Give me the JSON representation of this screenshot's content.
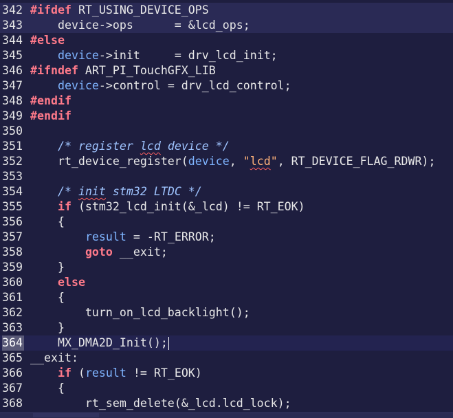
{
  "editor": {
    "cursor_line": "364",
    "lines": [
      {
        "num": "342",
        "tokens": [
          {
            "t": "pp",
            "v": "#ifdef"
          },
          {
            "t": "plain",
            "v": " RT_USING_DEVICE_OPS"
          }
        ]
      },
      {
        "num": "343",
        "tokens": [
          {
            "t": "plain",
            "v": "    device->ops      = &lcd_ops;"
          }
        ]
      },
      {
        "num": "344",
        "tokens": [
          {
            "t": "pp",
            "v": "#else"
          }
        ]
      },
      {
        "num": "345",
        "tokens": [
          {
            "t": "plain",
            "v": "    "
          },
          {
            "t": "var",
            "v": "device"
          },
          {
            "t": "plain",
            "v": "->init     = drv_lcd_init;"
          }
        ]
      },
      {
        "num": "346",
        "tokens": [
          {
            "t": "pp",
            "v": "#ifndef"
          },
          {
            "t": "plain",
            "v": " ART_PI_TouchGFX_LIB"
          }
        ]
      },
      {
        "num": "347",
        "tokens": [
          {
            "t": "plain",
            "v": "    "
          },
          {
            "t": "var",
            "v": "device"
          },
          {
            "t": "plain",
            "v": "->control = drv_lcd_control;"
          }
        ]
      },
      {
        "num": "348",
        "tokens": [
          {
            "t": "pp",
            "v": "#endif"
          }
        ]
      },
      {
        "num": "349",
        "tokens": [
          {
            "t": "pp",
            "v": "#endif"
          }
        ]
      },
      {
        "num": "350",
        "tokens": []
      },
      {
        "num": "351",
        "tokens": [
          {
            "t": "plain",
            "v": "    "
          },
          {
            "t": "cmt",
            "v": "/* register "
          },
          {
            "t": "cmtsq",
            "v": "lcd"
          },
          {
            "t": "cmt",
            "v": " device */"
          }
        ]
      },
      {
        "num": "352",
        "tokens": [
          {
            "t": "plain",
            "v": "    rt_device_register("
          },
          {
            "t": "var",
            "v": "device"
          },
          {
            "t": "plain",
            "v": ", "
          },
          {
            "t": "str",
            "v": "\""
          },
          {
            "t": "strsq",
            "v": "lcd"
          },
          {
            "t": "str",
            "v": "\""
          },
          {
            "t": "plain",
            "v": ", RT_DEVICE_FLAG_RDWR);"
          }
        ]
      },
      {
        "num": "353",
        "tokens": []
      },
      {
        "num": "354",
        "tokens": [
          {
            "t": "plain",
            "v": "    "
          },
          {
            "t": "cmt",
            "v": "/* "
          },
          {
            "t": "cmtsq",
            "v": "init"
          },
          {
            "t": "cmt",
            "v": " stm32 LTDC */"
          }
        ]
      },
      {
        "num": "355",
        "tokens": [
          {
            "t": "plain",
            "v": "    "
          },
          {
            "t": "kw",
            "v": "if"
          },
          {
            "t": "plain",
            "v": " (stm32_lcd_init(&_lcd) != RT_EOK)"
          }
        ]
      },
      {
        "num": "356",
        "tokens": [
          {
            "t": "plain",
            "v": "    {"
          }
        ]
      },
      {
        "num": "357",
        "tokens": [
          {
            "t": "plain",
            "v": "        "
          },
          {
            "t": "var",
            "v": "result"
          },
          {
            "t": "plain",
            "v": " = -RT_ERROR;"
          }
        ]
      },
      {
        "num": "358",
        "tokens": [
          {
            "t": "plain",
            "v": "        "
          },
          {
            "t": "kw",
            "v": "goto"
          },
          {
            "t": "plain",
            "v": " __exit;"
          }
        ]
      },
      {
        "num": "359",
        "tokens": [
          {
            "t": "plain",
            "v": "    }"
          }
        ]
      },
      {
        "num": "360",
        "tokens": [
          {
            "t": "plain",
            "v": "    "
          },
          {
            "t": "kw",
            "v": "else"
          }
        ]
      },
      {
        "num": "361",
        "tokens": [
          {
            "t": "plain",
            "v": "    {"
          }
        ]
      },
      {
        "num": "362",
        "tokens": [
          {
            "t": "plain",
            "v": "        turn_on_lcd_backlight();"
          }
        ]
      },
      {
        "num": "363",
        "tokens": [
          {
            "t": "plain",
            "v": "    }"
          }
        ]
      },
      {
        "num": "364",
        "tokens": [
          {
            "t": "plain",
            "v": "    MX_DMA2D_Init();"
          }
        ]
      },
      {
        "num": "365",
        "tokens": [
          {
            "t": "plain",
            "v": "__exit:"
          }
        ]
      },
      {
        "num": "366",
        "tokens": [
          {
            "t": "plain",
            "v": "    "
          },
          {
            "t": "kw",
            "v": "if"
          },
          {
            "t": "plain",
            "v": " ("
          },
          {
            "t": "var",
            "v": "result"
          },
          {
            "t": "plain",
            "v": " != RT_EOK)"
          }
        ]
      },
      {
        "num": "367",
        "tokens": [
          {
            "t": "plain",
            "v": "    {"
          }
        ]
      },
      {
        "num": "368",
        "tokens": [
          {
            "t": "plain",
            "v": "        rt_sem_delete(&_lcd.lcd_lock);"
          }
        ]
      }
    ]
  },
  "colors": {
    "background": "#1e1e3f",
    "preprocessor": "#ff7a8a",
    "keyword": "#ff7a8a",
    "variable": "#7fb4ff",
    "string": "#ffb27a",
    "comment": "#9fc4ff",
    "text": "#e8e8e8"
  }
}
